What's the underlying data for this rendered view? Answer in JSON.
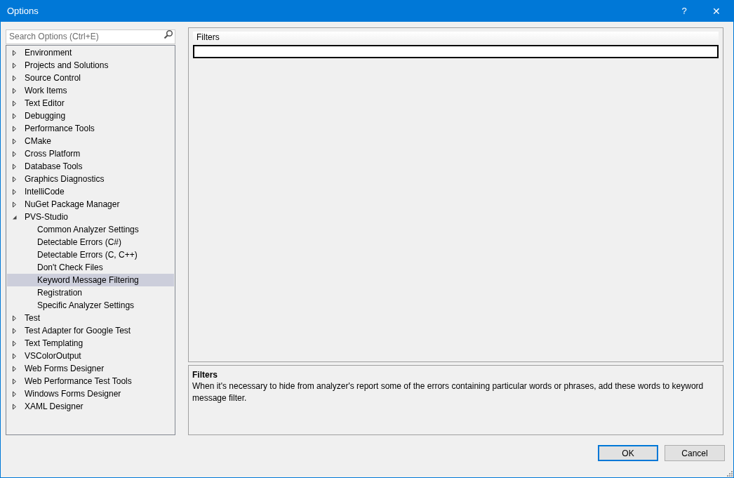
{
  "window": {
    "title": "Options",
    "help": "?",
    "close": "✕"
  },
  "search": {
    "placeholder": "Search Options (Ctrl+E)"
  },
  "tree": [
    {
      "label": "Environment",
      "expanded": false,
      "selected": false
    },
    {
      "label": "Projects and Solutions",
      "expanded": false,
      "selected": false
    },
    {
      "label": "Source Control",
      "expanded": false,
      "selected": false
    },
    {
      "label": "Work Items",
      "expanded": false,
      "selected": false
    },
    {
      "label": "Text Editor",
      "expanded": false,
      "selected": false
    },
    {
      "label": "Debugging",
      "expanded": false,
      "selected": false
    },
    {
      "label": "Performance Tools",
      "expanded": false,
      "selected": false
    },
    {
      "label": "CMake",
      "expanded": false,
      "selected": false
    },
    {
      "label": "Cross Platform",
      "expanded": false,
      "selected": false
    },
    {
      "label": "Database Tools",
      "expanded": false,
      "selected": false
    },
    {
      "label": "Graphics Diagnostics",
      "expanded": false,
      "selected": false
    },
    {
      "label": "IntelliCode",
      "expanded": false,
      "selected": false
    },
    {
      "label": "NuGet Package Manager",
      "expanded": false,
      "selected": false
    },
    {
      "label": "PVS-Studio",
      "expanded": true,
      "selected": false,
      "children": [
        {
          "label": "Common Analyzer Settings",
          "selected": false
        },
        {
          "label": "Detectable Errors (C#)",
          "selected": false
        },
        {
          "label": "Detectable Errors (C, C++)",
          "selected": false
        },
        {
          "label": "Don't Check Files",
          "selected": false
        },
        {
          "label": "Keyword Message Filtering",
          "selected": true
        },
        {
          "label": "Registration",
          "selected": false
        },
        {
          "label": "Specific Analyzer Settings",
          "selected": false
        }
      ]
    },
    {
      "label": "Test",
      "expanded": false,
      "selected": false
    },
    {
      "label": "Test Adapter for Google Test",
      "expanded": false,
      "selected": false
    },
    {
      "label": "Text Templating",
      "expanded": false,
      "selected": false
    },
    {
      "label": "VSColorOutput",
      "expanded": false,
      "selected": false
    },
    {
      "label": "Web Forms Designer",
      "expanded": false,
      "selected": false
    },
    {
      "label": "Web Performance Test Tools",
      "expanded": false,
      "selected": false
    },
    {
      "label": "Windows Forms Designer",
      "expanded": false,
      "selected": false
    },
    {
      "label": "XAML Designer",
      "expanded": false,
      "selected": false
    }
  ],
  "filters": {
    "column": "Filters"
  },
  "description": {
    "title": "Filters",
    "text": "When it's necessary to hide from analyzer's report some of the errors containing particular words or phrases, add these words to keyword message filter."
  },
  "buttons": [
    {
      "label": "OK",
      "default": true
    },
    {
      "label": "Cancel",
      "default": false
    }
  ]
}
